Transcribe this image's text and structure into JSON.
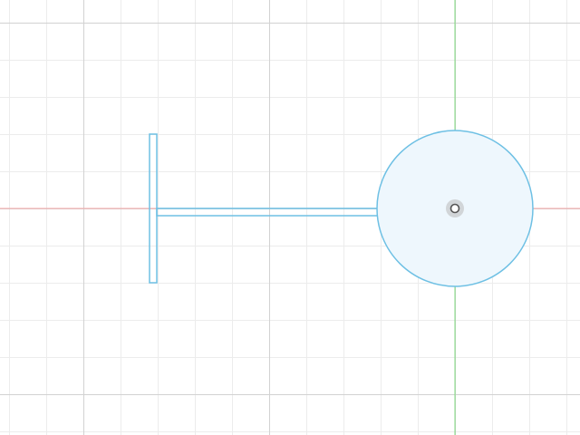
{
  "viewport": {
    "background": "#ffffff",
    "grid": {
      "visible": true,
      "minor_color": "#ececec",
      "major_color": "#d2d2d2"
    },
    "axes": {
      "x_axis_color": "#f4a6a6",
      "y_axis_color": "#7fdc7f"
    }
  },
  "sketch": {
    "profile_stroke": "#6ec0e4",
    "circle_fill": "#eef7fd",
    "origin_marker": {
      "ring_color": "#b9b9b9",
      "center_color": "#555555"
    },
    "shapes": [
      "vertical-bar",
      "horizontal-arm",
      "circle"
    ]
  }
}
